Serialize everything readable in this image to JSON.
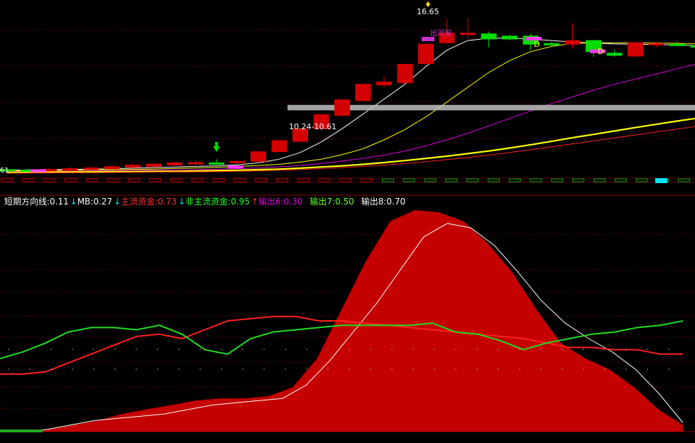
{
  "colors": {
    "background": "#000000",
    "grid": "#7a0000",
    "up": "#d40000",
    "down": "#00dd00",
    "white_line": "#ffffff",
    "yellow_line": "#ffff00",
    "magenta_line": "#e000e0",
    "red_line": "#ff2020",
    "green_line": "#22dd22",
    "fill_red": "#c40000",
    "label_red": "#ff3030",
    "label_green": "#22ff22",
    "label_magenta": "#e000e0",
    "label_lime": "#66ff33",
    "label_white": "#ffffff",
    "arrow_down": "#00e5ff",
    "arrow_up": "#ff3030",
    "band_gray": "#c0c0c0",
    "marker_cyan": "#00e5ff",
    "marker_magenta": "#ff40ff"
  },
  "chart_data": [
    {
      "type": "candlestick",
      "panel": "price",
      "grid": true,
      "price_range": [
        6.0,
        17.3
      ],
      "annotations": {
        "high_label": "16.65",
        "range_label": "10.24-10.61",
        "left_cut_label": "61",
        "d_marks": [
          "D",
          "D"
        ],
        "obscured_tag": "出河窗"
      },
      "candles": [
        {
          "open": 6.25,
          "close": 6.2,
          "high": 6.32,
          "low": 6.12
        },
        {
          "open": 6.22,
          "close": 6.18,
          "high": 6.3,
          "low": 6.1
        },
        {
          "open": 6.15,
          "close": 6.26,
          "high": 6.35,
          "low": 6.1
        },
        {
          "open": 6.2,
          "close": 6.32,
          "high": 6.4,
          "low": 6.12
        },
        {
          "open": 6.25,
          "close": 6.36,
          "high": 6.48,
          "low": 6.18
        },
        {
          "open": 6.3,
          "close": 6.45,
          "high": 6.58,
          "low": 6.25
        },
        {
          "open": 6.4,
          "close": 6.55,
          "high": 6.68,
          "low": 6.35
        },
        {
          "open": 6.45,
          "close": 6.62,
          "high": 6.7,
          "low": 6.4
        },
        {
          "open": 6.55,
          "close": 6.7,
          "high": 6.82,
          "low": 6.5
        },
        {
          "open": 6.62,
          "close": 6.72,
          "high": 6.92,
          "low": 6.55
        },
        {
          "open": 6.7,
          "close": 6.66,
          "high": 6.95,
          "low": 6.58
        },
        {
          "open": 6.72,
          "close": 6.8,
          "high": 6.92,
          "low": 6.62
        },
        {
          "open": 6.8,
          "close": 7.45,
          "high": 7.45,
          "low": 6.75
        },
        {
          "open": 7.45,
          "close": 8.2,
          "high": 8.2,
          "low": 7.45
        },
        {
          "open": 8.15,
          "close": 9.0,
          "high": 9.0,
          "low": 8.1
        },
        {
          "open": 9.0,
          "close": 9.95,
          "high": 9.95,
          "low": 8.95
        },
        {
          "open": 9.9,
          "close": 10.95,
          "high": 10.95,
          "low": 9.85
        },
        {
          "open": 10.9,
          "close": 12.0,
          "high": 12.0,
          "low": 10.85
        },
        {
          "open": 11.95,
          "close": 12.15,
          "high": 12.55,
          "low": 11.8
        },
        {
          "open": 12.1,
          "close": 13.35,
          "high": 13.35,
          "low": 12.0
        },
        {
          "open": 13.4,
          "close": 14.7,
          "high": 14.7,
          "low": 13.35
        },
        {
          "open": 14.8,
          "close": 15.45,
          "high": 16.4,
          "low": 14.7
        },
        {
          "open": 15.35,
          "close": 15.45,
          "high": 16.45,
          "low": 14.95
        },
        {
          "open": 15.4,
          "close": 15.05,
          "high": 15.55,
          "low": 14.5
        },
        {
          "open": 15.25,
          "close": 15.05,
          "high": 15.35,
          "low": 14.95
        },
        {
          "open": 15.25,
          "close": 14.7,
          "high": 15.4,
          "low": 14.3
        },
        {
          "open": 14.75,
          "close": 14.65,
          "high": 14.85,
          "low": 14.5
        },
        {
          "open": 14.7,
          "close": 14.95,
          "high": 16.1,
          "low": 14.4
        },
        {
          "open": 14.95,
          "close": 14.2,
          "high": 15.0,
          "low": 13.85
        },
        {
          "open": 14.1,
          "close": 13.95,
          "high": 14.3,
          "low": 13.85
        },
        {
          "open": 13.9,
          "close": 14.8,
          "high": 14.85,
          "low": 13.8
        },
        {
          "open": 14.65,
          "close": 14.75,
          "high": 14.85,
          "low": 14.5
        },
        {
          "open": 14.7,
          "close": 14.65,
          "high": 14.9,
          "low": 14.55
        },
        {
          "open": 14.6,
          "close": 14.55,
          "high": 14.7,
          "low": 14.4
        },
        {
          "open": 14.7,
          "close": 13.75,
          "high": 14.75,
          "low": 13.4
        },
        {
          "open": 13.7,
          "close": 13.6,
          "high": 13.9,
          "low": 13.4
        }
      ],
      "ma_series": [
        {
          "color": "white_line",
          "values": [
            6.2,
            6.22,
            6.24,
            6.26,
            6.28,
            6.3,
            6.34,
            6.38,
            6.42,
            6.46,
            6.5,
            6.56,
            6.7,
            6.95,
            7.4,
            8.1,
            9.0,
            10.0,
            11.0,
            12.0,
            13.2,
            14.3,
            14.95,
            15.1,
            15.12,
            15.05,
            14.95,
            14.85,
            14.78,
            14.72,
            14.7,
            14.68,
            14.65,
            14.6,
            14.55,
            14.5
          ]
        },
        {
          "color": "yellow_line",
          "values": [
            6.15,
            6.17,
            6.18,
            6.2,
            6.22,
            6.24,
            6.26,
            6.28,
            6.32,
            6.36,
            6.4,
            6.45,
            6.52,
            6.6,
            6.75,
            6.95,
            7.25,
            7.65,
            8.25,
            8.95,
            9.8,
            10.8,
            11.8,
            12.8,
            13.6,
            14.2,
            14.55,
            14.75,
            14.8,
            14.8,
            14.8,
            14.78,
            14.76,
            14.72,
            14.65,
            14.55
          ]
        },
        {
          "color": "magenta_line",
          "values": [
            6.1,
            6.12,
            6.13,
            6.14,
            6.16,
            6.18,
            6.2,
            6.21,
            6.23,
            6.25,
            6.28,
            6.31,
            6.36,
            6.43,
            6.52,
            6.65,
            6.82,
            7.0,
            7.22,
            7.5,
            7.85,
            8.25,
            8.7,
            9.2,
            9.7,
            10.2,
            10.7,
            11.15,
            11.6,
            12.0,
            12.35,
            12.7,
            13.05,
            13.4,
            13.7,
            13.95
          ]
        },
        {
          "color": "yellow_line",
          "bold": true,
          "values": [
            6.05,
            6.06,
            6.07,
            6.08,
            6.09,
            6.1,
            6.11,
            6.12,
            6.13,
            6.15,
            6.17,
            6.2,
            6.24,
            6.28,
            6.34,
            6.42,
            6.5,
            6.6,
            6.72,
            6.85,
            7.0,
            7.15,
            7.32,
            7.5,
            7.7,
            7.92,
            8.15,
            8.4,
            8.62,
            8.85,
            9.08,
            9.3,
            9.52,
            9.72,
            9.9,
            10.05
          ]
        },
        {
          "color": "red_line",
          "values": [
            6.0,
            6.01,
            6.02,
            6.03,
            6.04,
            6.05,
            6.06,
            6.07,
            6.08,
            6.09,
            6.11,
            6.13,
            6.16,
            6.2,
            6.25,
            6.31,
            6.38,
            6.46,
            6.55,
            6.66,
            6.78,
            6.92,
            7.06,
            7.22,
            7.4,
            7.58,
            7.78,
            7.98,
            8.18,
            8.38,
            8.58,
            8.78,
            8.98,
            9.18,
            9.36,
            9.52
          ]
        }
      ]
    },
    {
      "type": "area",
      "panel": "indicator",
      "grid": true,
      "y_range": [
        0,
        1
      ],
      "legend": [
        {
          "label": "短期方向线:0.11",
          "color": "label_white",
          "arrow": "↓"
        },
        {
          "label": "MB:0.27",
          "color": "label_white",
          "arrow": "↓"
        },
        {
          "label": "主流资金:0.73",
          "color": "label_red",
          "arrow": "↓"
        },
        {
          "label": "非主流资金:0.95",
          "color": "label_green",
          "arrow": "↑"
        },
        {
          "label": "输出6:0.30",
          "color": "label_magenta"
        },
        {
          "label": "输出7:0.50",
          "color": "label_lime"
        },
        {
          "label": "输出8:0.70",
          "color": "label_white"
        }
      ],
      "series": [
        {
          "color": "fill_red",
          "kind": "area",
          "values": [
            0.0,
            0.0,
            0.01,
            0.03,
            0.05,
            0.08,
            0.1,
            0.12,
            0.14,
            0.15,
            0.15,
            0.16,
            0.2,
            0.33,
            0.55,
            0.77,
            0.95,
            1.0,
            0.99,
            0.95,
            0.85,
            0.72,
            0.55,
            0.4,
            0.33,
            0.28,
            0.2,
            0.1,
            0.03
          ]
        },
        {
          "color": "white_line",
          "kind": "line",
          "values": [
            0.0,
            0.0,
            0.01,
            0.03,
            0.05,
            0.06,
            0.07,
            0.08,
            0.1,
            0.12,
            0.13,
            0.14,
            0.15,
            0.21,
            0.32,
            0.45,
            0.58,
            0.73,
            0.88,
            0.94,
            0.92,
            0.84,
            0.72,
            0.59,
            0.49,
            0.42,
            0.36,
            0.28,
            0.17,
            0.04
          ]
        },
        {
          "color": "red_line",
          "kind": "line",
          "values": [
            0.26,
            0.26,
            0.27,
            0.31,
            0.35,
            0.39,
            0.43,
            0.44,
            0.42,
            0.46,
            0.5,
            0.51,
            0.52,
            0.52,
            0.5,
            0.5,
            0.49,
            0.48,
            0.47,
            0.46,
            0.45,
            0.44,
            0.43,
            0.42,
            0.4,
            0.38,
            0.38,
            0.37,
            0.37,
            0.35,
            0.35
          ]
        },
        {
          "color": "green_line",
          "kind": "line",
          "values": [
            0.33,
            0.36,
            0.4,
            0.45,
            0.47,
            0.47,
            0.46,
            0.48,
            0.44,
            0.37,
            0.35,
            0.42,
            0.45,
            0.46,
            0.47,
            0.48,
            0.48,
            0.48,
            0.48,
            0.49,
            0.45,
            0.44,
            0.41,
            0.37,
            0.4,
            0.42,
            0.44,
            0.45,
            0.47,
            0.48,
            0.5
          ]
        }
      ]
    }
  ]
}
